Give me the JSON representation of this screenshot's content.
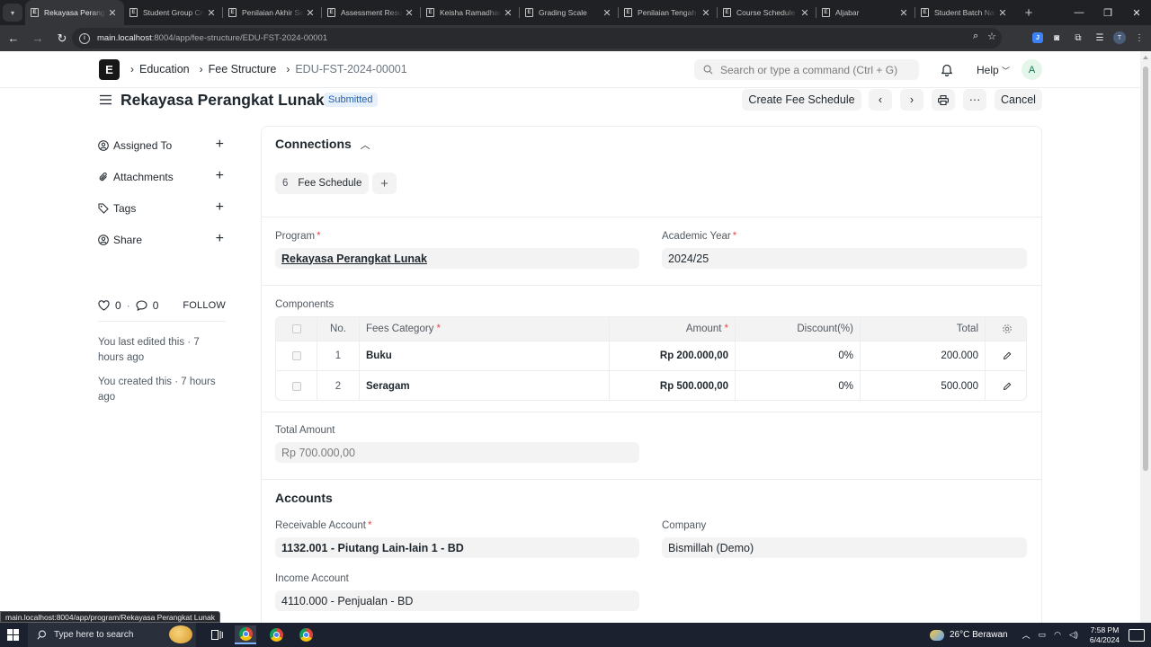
{
  "browser": {
    "tabs": [
      {
        "title": "Rekayasa Perangkat Lunak",
        "active": true
      },
      {
        "title": "Student Group Creation Tool"
      },
      {
        "title": "Penilaian Akhir Semester"
      },
      {
        "title": "Assessment Result"
      },
      {
        "title": "Keisha Ramadhani"
      },
      {
        "title": "Grading Scale"
      },
      {
        "title": "Penilaian Tengah Semester"
      },
      {
        "title": "Course Schedule"
      },
      {
        "title": "Aljabar"
      },
      {
        "title": "Student Batch Name"
      }
    ],
    "url_host": "main.localhost",
    "url_rest": ":8004/app/fee-structure/EDU-FST-2024-00001",
    "status_url": "main.localhost:8004/app/program/Rekayasa Perangkat Lunak",
    "profile_initial": "T"
  },
  "navbar": {
    "breadcrumbs": [
      "Education",
      "Fee Structure",
      "EDU-FST-2024-00001"
    ],
    "search_placeholder": "Search or type a command (Ctrl + G)",
    "help_label": "Help",
    "avatar_initial": "A"
  },
  "page": {
    "title": "Rekayasa Perangkat Lunak",
    "status": "Submitted",
    "create_label": "Create Fee Schedule",
    "cancel_label": "Cancel",
    "more_label": "···"
  },
  "sidebar": {
    "items": [
      {
        "label": "Assigned To"
      },
      {
        "label": "Attachments"
      },
      {
        "label": "Tags"
      },
      {
        "label": "Share"
      }
    ],
    "likes": "0",
    "comments": "0",
    "follow_label": "FOLLOW",
    "last_edited": "You last edited this · 7 hours ago",
    "created": "You created this · 7 hours ago"
  },
  "connections": {
    "title": "Connections",
    "count": "6",
    "label": "Fee Schedule"
  },
  "form": {
    "program_label": "Program",
    "program_value": "Rekayasa Perangkat Lunak",
    "academic_year_label": "Academic Year",
    "academic_year_value": "2024/25",
    "components_label": "Components",
    "total_amount_label": "Total Amount",
    "total_amount_value": "Rp 700.000,00",
    "accounts_title": "Accounts",
    "receivable_label": "Receivable Account",
    "receivable_value": "1132.001 - Piutang Lain-lain 1 - BD",
    "company_label": "Company",
    "company_value": "Bismillah (Demo)",
    "income_label": "Income Account",
    "income_value": "4110.000 - Penjualan - BD"
  },
  "table": {
    "headers": {
      "no": "No.",
      "category": "Fees Category",
      "amount": "Amount",
      "discount": "Discount(%)",
      "total": "Total"
    },
    "rows": [
      {
        "no": "1",
        "category": "Buku",
        "amount": "Rp 200.000,00",
        "discount": "0%",
        "total": "200.000"
      },
      {
        "no": "2",
        "category": "Seragam",
        "amount": "Rp 500.000,00",
        "discount": "0%",
        "total": "500.000"
      }
    ]
  },
  "taskbar": {
    "search_placeholder": "Type here to search",
    "weather": "26°C  Berawan",
    "time": "7:58 PM",
    "date": "6/4/2024"
  },
  "colors": {
    "status_badge_bg": "#e6f0fb",
    "status_badge_text": "#2361b1",
    "required": "#e24c4c",
    "chrome_dark": "#202124"
  }
}
